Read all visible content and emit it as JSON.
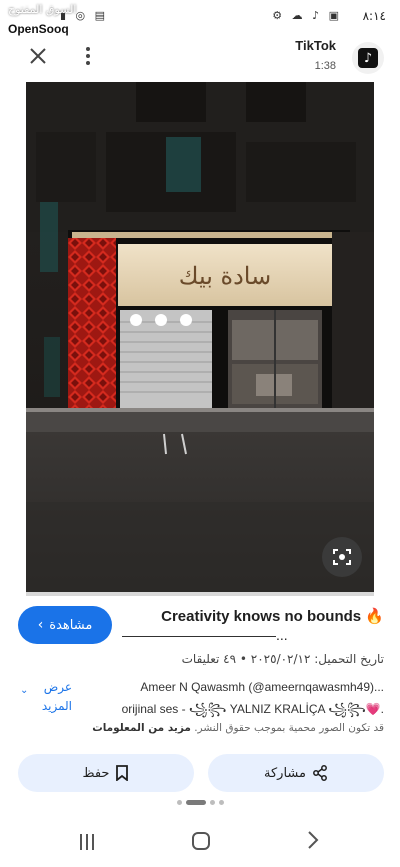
{
  "status_bar": {
    "time": "٨:١٤",
    "right_icons": "⚙ ☁ ♪ ▣",
    "left_icons": "▮ ◎ ▤"
  },
  "watermark": {
    "arabic": "السوق المفتوح",
    "brand": "OpenSooq"
  },
  "header": {
    "close_icon": "close-icon",
    "more_icon": "more-vert-icon",
    "app_name": "TikTok",
    "duration": "1:38",
    "logo_icon": "tiktok-logo-icon",
    "logo_glyph": "♪"
  },
  "image": {
    "lens_icon": "lens-search-icon",
    "storefront_sign": "سادة بيك"
  },
  "caption": {
    "view_button_label": "مشاهدة",
    "view_button_icon": "chevron-left-icon",
    "title": "Creativity knows no bounds",
    "title_emoji": "🔥",
    "title_line2": "———————————...",
    "meta": "تاريخ التحميل: ٢٠٢٥/٠٢/١٢ • ٤٩ تعليقات",
    "more_toggle_label": "عرض المزيد",
    "description_line1": "Ameer N Qawasmh (@ameernqawasmh49)...",
    "description_line2": "orijinal ses - ꧁꧂ YALNIZ KRALİÇA ꧁꧂💗.",
    "copyright_text": "قد تكون الصور محمية بموجب حقوق النشر.",
    "copyright_link": "مزيد من المعلومات"
  },
  "actions": {
    "save_label": "حفظ",
    "save_icon": "bookmark-icon",
    "share_label": "مشاركة",
    "share_icon": "share-icon"
  },
  "pager": {
    "count": 4,
    "active_index": 1
  },
  "nav": {
    "recents_icon": "recents-icon",
    "home_icon": "home-icon",
    "back_icon": "back-icon"
  },
  "colors": {
    "accent": "#1a73e8",
    "pill_bg": "#e8f0fe",
    "sign_glow": "#e8d8b8",
    "red_panel": "#c8201a"
  }
}
